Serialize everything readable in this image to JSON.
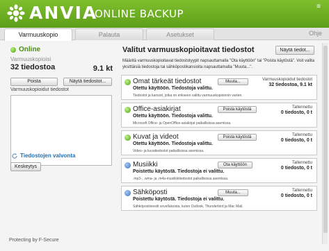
{
  "header": {
    "brand": "ANVIA",
    "product": "ONLINE BACKUP",
    "menu_icon": "menu-icon"
  },
  "tabs": [
    {
      "label": "Varmuuskopio",
      "active": true
    },
    {
      "label": "Palauta",
      "active": false
    },
    {
      "label": "Asetukset",
      "active": false
    }
  ],
  "help_label": "Ohje",
  "left": {
    "status": "Online",
    "backup_label": "Varmuuskopioisi",
    "files_count": "32 tiedostoa",
    "files_size": "9.1 kt",
    "remove_button": "Poista",
    "show_files_button": "Näytä tiedostot...",
    "backed_up_label": "Varmuuskopioidut tiedostot",
    "monitoring_label": "Tiedostojen valvonta",
    "pause_button": "Keskeytys",
    "powered_by": "Protecting by F-Secure"
  },
  "right": {
    "title": "Valitut varmuuskopioitavat tiedostot",
    "show_files_button": "Näytä tiedot...",
    "description": "Määritä varmuuskopioitavat tiedostotyypit napsauttamalla \"Ota käyttöön\" tai \"Poista käytöstä\". Voit valita yksittäisiä tiedostoja tai sähköpostikansioita napsauttamalla \"Muuta...\".",
    "cards": [
      {
        "name": "Omat tärkeät tiedostot",
        "status": "Otettu käyttöön. Tiedostoja valittu.",
        "desc": "Tiedostot ja kansiot, jotka on erikseen valittu varmuuskopioinnin varten.",
        "button": "Muuta...",
        "meta_label": "Varmuuskopioidut tiedostot",
        "meta_value": "32 tiedostoa, 9.1 kt",
        "dot": "green"
      },
      {
        "name": "Office-asiakirjat",
        "status": "Otettu käyttöön. Tiedostoja valittu.",
        "desc": "Microsoft Office- ja OpenOffice-asiakirjat paikallisissa asemissa.",
        "button": "Poista käytöstä",
        "meta_label": "Tallennettu",
        "meta_value": "0 tiedosto, 0 t",
        "dot": "green"
      },
      {
        "name": "Kuvat ja videot",
        "status": "Otettu käyttöön. Tiedostoja valittu.",
        "desc": "Video- ja kuvatiedostot paikallisissa asemissa.",
        "button": "Poista käytöstä",
        "meta_label": "Tallennettu",
        "meta_value": "0 tiedosto, 0 t",
        "dot": "green"
      },
      {
        "name": "Musiikki",
        "status": "Poistettu käytöstä. Tiedostoja ei valittu.",
        "desc": ".mp3-, .wma- ja .m4a-musiikkitiedostot paikallisissa asemissa.",
        "button": "Ota käyttöön",
        "meta_label": "Tallennettu",
        "meta_value": "0 tiedosto, 0 t",
        "dot": "blue"
      },
      {
        "name": "Sähköposti",
        "status": "Poistettu käytöstä. Tiedostoja ei valittu.",
        "desc": "Sähköpostiviestit sovelluksista, kuten Outlook, Thunderbird ja Mac Mail.",
        "button": "Muuta...",
        "meta_label": "Tallennettu",
        "meta_value": "0 tiedosto, 0 t",
        "dot": "blue"
      }
    ]
  },
  "colors": {
    "brand_green": "#5d9e18",
    "online_green": "#4a8f13",
    "link_blue": "#1d6fb8"
  }
}
